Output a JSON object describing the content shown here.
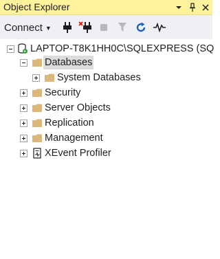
{
  "panel": {
    "title": "Object Explorer",
    "dropdown_icon": "dropdown-arrow",
    "pin_icon": "pin",
    "close_icon": "close"
  },
  "toolbar": {
    "connect_label": "Connect",
    "icons": [
      "connect-object-explorer-icon",
      "disconnect-icon",
      "stop-icon",
      "filter-icon",
      "refresh-icon",
      "activity-monitor-icon"
    ]
  },
  "tree": {
    "server": {
      "label": "LAPTOP-T8K1HH0C\\SQLEXPRESS (SQ",
      "expanded": true
    },
    "databases": {
      "label": "Databases",
      "expanded": true,
      "selected": true
    },
    "system_databases": {
      "label": "System Databases",
      "expanded": false
    },
    "security": {
      "label": "Security",
      "expanded": false
    },
    "server_objects": {
      "label": "Server Objects",
      "expanded": false
    },
    "replication": {
      "label": "Replication",
      "expanded": false
    },
    "management": {
      "label": "Management",
      "expanded": false
    },
    "xevent_profiler": {
      "label": "XEvent Profiler",
      "expanded": false
    }
  },
  "colors": {
    "title_bar": "#fff29d",
    "toolbar_bg": "#eef0f5",
    "folder": "#dcb67a",
    "refresh_blue": "#1e63b8",
    "disconnect_red": "#e51400",
    "server_green": "#3a9d3a"
  }
}
